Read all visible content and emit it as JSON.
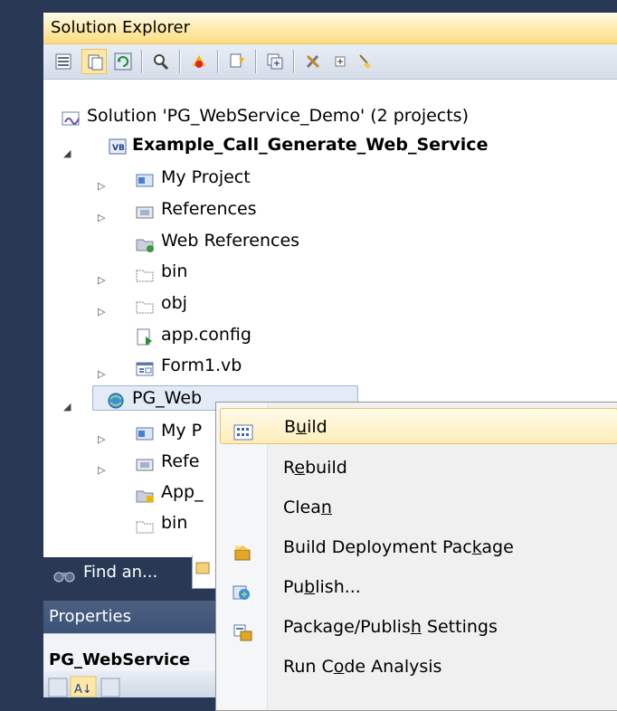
{
  "solution_explorer": {
    "title": "Solution Explorer",
    "toolbar": [
      "properties-icon",
      "show-all-files-icon",
      "refresh-icon",
      "view-class-diagram-icon",
      "extension-icon",
      "nested-icon",
      "copy-website-icon",
      "wrench-icon",
      "expand-icon",
      "sweep-icon"
    ],
    "tree": {
      "solution": "Solution 'PG_WebService_Demo' (2 projects)",
      "project1": {
        "name": "Example_Call_Generate_Web_Service",
        "items": [
          "My Project",
          "References",
          "Web References",
          "bin",
          "obj",
          "app.config",
          "Form1.vb"
        ]
      },
      "project2": {
        "name": "PG_WebService_Demo",
        "visible_name": "PG_Web",
        "items": [
          "My P",
          "Refe",
          "App_",
          "bin"
        ]
      }
    }
  },
  "bottom_tabs": {
    "find": "Find an..."
  },
  "properties": {
    "title": "Properties",
    "object": "PG_WebService"
  },
  "context_menu": {
    "items": [
      {
        "pre": "B",
        "ul": "u",
        "post": "ild",
        "icon": "build-icon",
        "highlighted": true
      },
      {
        "pre": "R",
        "ul": "e",
        "post": "build",
        "icon": "",
        "highlighted": false
      },
      {
        "pre": "Clea",
        "ul": "n",
        "post": "",
        "icon": "",
        "highlighted": false
      },
      {
        "pre": "Build Deployment Pac",
        "ul": "k",
        "post": "age",
        "icon": "deploy-package-icon",
        "highlighted": false
      },
      {
        "pre": "Pu",
        "ul": "b",
        "post": "lish...",
        "icon": "publish-icon",
        "highlighted": false
      },
      {
        "pre": "Package/Publis",
        "ul": "h",
        "post": " Settings",
        "icon": "package-settings-icon",
        "highlighted": false
      },
      {
        "pre": "Run C",
        "ul": "o",
        "post": "de Analysis",
        "icon": "",
        "highlighted": false
      }
    ]
  },
  "colors": {
    "background": "#293955",
    "title_bar": "#ffe8a6",
    "highlight": "#ffeebb"
  }
}
